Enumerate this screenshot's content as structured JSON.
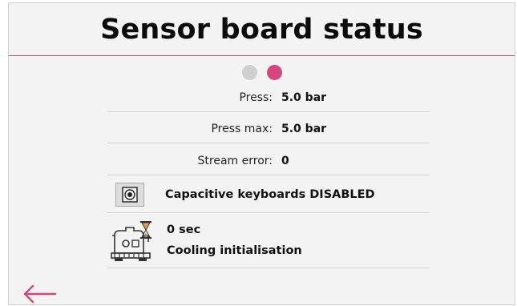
{
  "header": {
    "title": "Sensor board status"
  },
  "pager": {
    "pages": 2,
    "active_index": 1
  },
  "rows": {
    "press": {
      "label": "Press:",
      "value": "5.0 bar"
    },
    "press_max": {
      "label": "Press max:",
      "value": "5.0 bar"
    },
    "stream_error": {
      "label": "Stream error:",
      "value": "0"
    },
    "capacitive": {
      "text": "Capacitive keyboards DISABLED",
      "icon": "capacitive-key-icon"
    },
    "cooling": {
      "time": "0 sec",
      "status": "Cooling initialisation",
      "icon": "machine-hourglass-icon"
    }
  },
  "nav": {
    "back_icon": "back-arrow-icon"
  },
  "colors": {
    "accent": "#d6457f",
    "rule": "#c64d82",
    "inactive_dot": "#cfcfcf",
    "background": "#f3f3f3"
  }
}
